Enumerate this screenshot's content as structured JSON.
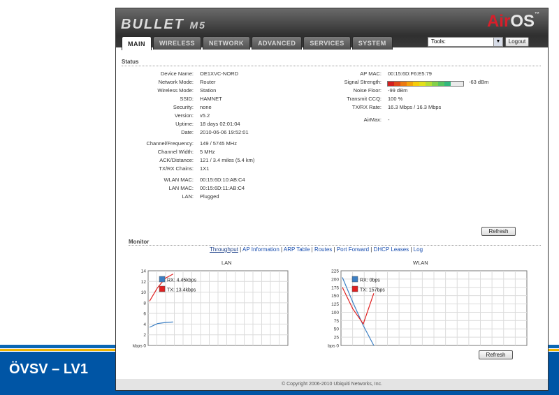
{
  "slide": {
    "band_title": "ÖVSV – LV1"
  },
  "header": {
    "product": "BULLET",
    "product_suffix": "M5",
    "brand_air": "Air",
    "brand_os": "OS",
    "brand_tm": "™"
  },
  "tabs": [
    "MAIN",
    "WIRELESS",
    "NETWORK",
    "ADVANCED",
    "SERVICES",
    "SYSTEM"
  ],
  "toolbar": {
    "tools_label": "Tools:",
    "tools_value": "",
    "logout_label": "Logout"
  },
  "status": {
    "title": "Status",
    "left": [
      {
        "label": "Device Name:",
        "value": "OE1XVC-NORD"
      },
      {
        "label": "Network Mode:",
        "value": "Router"
      },
      {
        "label": "Wireless Mode:",
        "value": "Station"
      },
      {
        "label": "SSID:",
        "value": "HAMNET"
      },
      {
        "label": "Security:",
        "value": "none"
      },
      {
        "label": "Version:",
        "value": "v5.2"
      },
      {
        "label": "Uptime:",
        "value": "18 days 02:01:04"
      },
      {
        "label": "Date:",
        "value": "2010-06-06 19:52:01"
      },
      {
        "label": "Channel/Frequency:",
        "value": "149  /  5745 MHz"
      },
      {
        "label": "Channel Width:",
        "value": "5 MHz"
      },
      {
        "label": "ACK/Distance:",
        "value": "121 / 3.4 miles (5.4 km)"
      },
      {
        "label": "TX/RX Chains:",
        "value": "1X1"
      },
      {
        "label": "WLAN MAC:",
        "value": "00:15:6D:10:AB:C4"
      },
      {
        "label": "LAN MAC:",
        "value": "00:15:6D:11:AB:C4"
      },
      {
        "label": "LAN:",
        "value": "Plugged"
      }
    ],
    "right": [
      {
        "label": "AP MAC:",
        "value": "00:15:6D:F6:E5:79"
      },
      {
        "label": "Signal Strength:",
        "value": "-63 dBm"
      },
      {
        "label": "Noise Floor:",
        "value": "-99 dBm"
      },
      {
        "label": "Transmit CCQ:",
        "value": "100 %"
      },
      {
        "label": "TX/RX Rate:",
        "value": "16.3 Mbps  /  16.3 Mbps"
      },
      {
        "label": "AirMax:",
        "value": "-"
      }
    ],
    "signal_level": 0.85,
    "refresh_label": "Refresh"
  },
  "monitor": {
    "title": "Monitor",
    "links": [
      "Throughput",
      "AP Information",
      "ARP Table",
      "Routes",
      "Port Forward",
      "DHCP Leases",
      "Log"
    ],
    "active_link": "Throughput",
    "refresh_label": "Refresh"
  },
  "colors": {
    "rx": "#3b7fc4",
    "tx": "#e02020"
  },
  "chart_data": [
    {
      "type": "line",
      "title": "LAN",
      "ylim": [
        0,
        14
      ],
      "yticks": [
        "14",
        "12",
        "10",
        "8",
        "6",
        "4",
        "2",
        "kbps 0"
      ],
      "grid": true,
      "legend": [
        {
          "name": "RX: 4.45kbps",
          "color": "#3b7fc4"
        },
        {
          "name": "TX: 13.4kbps",
          "color": "#e02020"
        }
      ],
      "series": [
        {
          "name": "RX: 4.45kbps",
          "values": [
            3.4,
            4.1,
            4.3,
            4.4
          ]
        },
        {
          "name": "TX: 13.4kbps",
          "values": [
            8.3,
            10.8,
            12.6,
            13.4
          ]
        }
      ]
    },
    {
      "type": "line",
      "title": "WLAN",
      "ylim": [
        0,
        225
      ],
      "yticks": [
        "225",
        "200",
        "175",
        "150",
        "125",
        "100",
        "75",
        "50",
        "25",
        "bps 0"
      ],
      "grid": true,
      "legend": [
        {
          "name": "RX: 0bps",
          "color": "#3b7fc4"
        },
        {
          "name": "TX: 157bps",
          "color": "#e02020"
        }
      ],
      "series": [
        {
          "name": "RX: 0bps",
          "values": [
            205,
            130,
            60,
            0
          ]
        },
        {
          "name": "TX: 157bps",
          "values": [
            175,
            110,
            65,
            157
          ]
        }
      ]
    }
  ],
  "footer": {
    "copyright": "© Copyright 2006-2010 Ubiquiti Networks, Inc."
  }
}
